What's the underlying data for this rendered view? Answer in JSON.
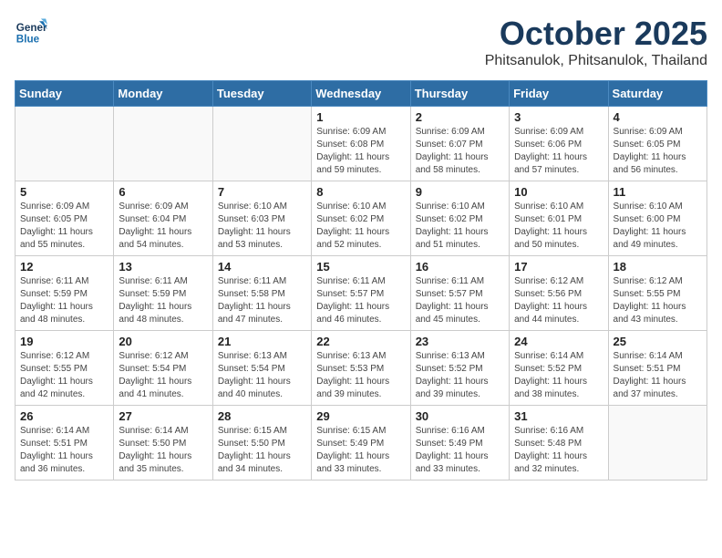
{
  "header": {
    "logo_line1": "General",
    "logo_line2": "Blue",
    "month": "October 2025",
    "location": "Phitsanulok, Phitsanulok, Thailand"
  },
  "weekdays": [
    "Sunday",
    "Monday",
    "Tuesday",
    "Wednesday",
    "Thursday",
    "Friday",
    "Saturday"
  ],
  "weeks": [
    [
      {
        "day": "",
        "info": ""
      },
      {
        "day": "",
        "info": ""
      },
      {
        "day": "",
        "info": ""
      },
      {
        "day": "1",
        "info": "Sunrise: 6:09 AM\nSunset: 6:08 PM\nDaylight: 11 hours\nand 59 minutes."
      },
      {
        "day": "2",
        "info": "Sunrise: 6:09 AM\nSunset: 6:07 PM\nDaylight: 11 hours\nand 58 minutes."
      },
      {
        "day": "3",
        "info": "Sunrise: 6:09 AM\nSunset: 6:06 PM\nDaylight: 11 hours\nand 57 minutes."
      },
      {
        "day": "4",
        "info": "Sunrise: 6:09 AM\nSunset: 6:05 PM\nDaylight: 11 hours\nand 56 minutes."
      }
    ],
    [
      {
        "day": "5",
        "info": "Sunrise: 6:09 AM\nSunset: 6:05 PM\nDaylight: 11 hours\nand 55 minutes."
      },
      {
        "day": "6",
        "info": "Sunrise: 6:09 AM\nSunset: 6:04 PM\nDaylight: 11 hours\nand 54 minutes."
      },
      {
        "day": "7",
        "info": "Sunrise: 6:10 AM\nSunset: 6:03 PM\nDaylight: 11 hours\nand 53 minutes."
      },
      {
        "day": "8",
        "info": "Sunrise: 6:10 AM\nSunset: 6:02 PM\nDaylight: 11 hours\nand 52 minutes."
      },
      {
        "day": "9",
        "info": "Sunrise: 6:10 AM\nSunset: 6:02 PM\nDaylight: 11 hours\nand 51 minutes."
      },
      {
        "day": "10",
        "info": "Sunrise: 6:10 AM\nSunset: 6:01 PM\nDaylight: 11 hours\nand 50 minutes."
      },
      {
        "day": "11",
        "info": "Sunrise: 6:10 AM\nSunset: 6:00 PM\nDaylight: 11 hours\nand 49 minutes."
      }
    ],
    [
      {
        "day": "12",
        "info": "Sunrise: 6:11 AM\nSunset: 5:59 PM\nDaylight: 11 hours\nand 48 minutes."
      },
      {
        "day": "13",
        "info": "Sunrise: 6:11 AM\nSunset: 5:59 PM\nDaylight: 11 hours\nand 48 minutes."
      },
      {
        "day": "14",
        "info": "Sunrise: 6:11 AM\nSunset: 5:58 PM\nDaylight: 11 hours\nand 47 minutes."
      },
      {
        "day": "15",
        "info": "Sunrise: 6:11 AM\nSunset: 5:57 PM\nDaylight: 11 hours\nand 46 minutes."
      },
      {
        "day": "16",
        "info": "Sunrise: 6:11 AM\nSunset: 5:57 PM\nDaylight: 11 hours\nand 45 minutes."
      },
      {
        "day": "17",
        "info": "Sunrise: 6:12 AM\nSunset: 5:56 PM\nDaylight: 11 hours\nand 44 minutes."
      },
      {
        "day": "18",
        "info": "Sunrise: 6:12 AM\nSunset: 5:55 PM\nDaylight: 11 hours\nand 43 minutes."
      }
    ],
    [
      {
        "day": "19",
        "info": "Sunrise: 6:12 AM\nSunset: 5:55 PM\nDaylight: 11 hours\nand 42 minutes."
      },
      {
        "day": "20",
        "info": "Sunrise: 6:12 AM\nSunset: 5:54 PM\nDaylight: 11 hours\nand 41 minutes."
      },
      {
        "day": "21",
        "info": "Sunrise: 6:13 AM\nSunset: 5:54 PM\nDaylight: 11 hours\nand 40 minutes."
      },
      {
        "day": "22",
        "info": "Sunrise: 6:13 AM\nSunset: 5:53 PM\nDaylight: 11 hours\nand 39 minutes."
      },
      {
        "day": "23",
        "info": "Sunrise: 6:13 AM\nSunset: 5:52 PM\nDaylight: 11 hours\nand 39 minutes."
      },
      {
        "day": "24",
        "info": "Sunrise: 6:14 AM\nSunset: 5:52 PM\nDaylight: 11 hours\nand 38 minutes."
      },
      {
        "day": "25",
        "info": "Sunrise: 6:14 AM\nSunset: 5:51 PM\nDaylight: 11 hours\nand 37 minutes."
      }
    ],
    [
      {
        "day": "26",
        "info": "Sunrise: 6:14 AM\nSunset: 5:51 PM\nDaylight: 11 hours\nand 36 minutes."
      },
      {
        "day": "27",
        "info": "Sunrise: 6:14 AM\nSunset: 5:50 PM\nDaylight: 11 hours\nand 35 minutes."
      },
      {
        "day": "28",
        "info": "Sunrise: 6:15 AM\nSunset: 5:50 PM\nDaylight: 11 hours\nand 34 minutes."
      },
      {
        "day": "29",
        "info": "Sunrise: 6:15 AM\nSunset: 5:49 PM\nDaylight: 11 hours\nand 33 minutes."
      },
      {
        "day": "30",
        "info": "Sunrise: 6:16 AM\nSunset: 5:49 PM\nDaylight: 11 hours\nand 33 minutes."
      },
      {
        "day": "31",
        "info": "Sunrise: 6:16 AM\nSunset: 5:48 PM\nDaylight: 11 hours\nand 32 minutes."
      },
      {
        "day": "",
        "info": ""
      }
    ]
  ]
}
